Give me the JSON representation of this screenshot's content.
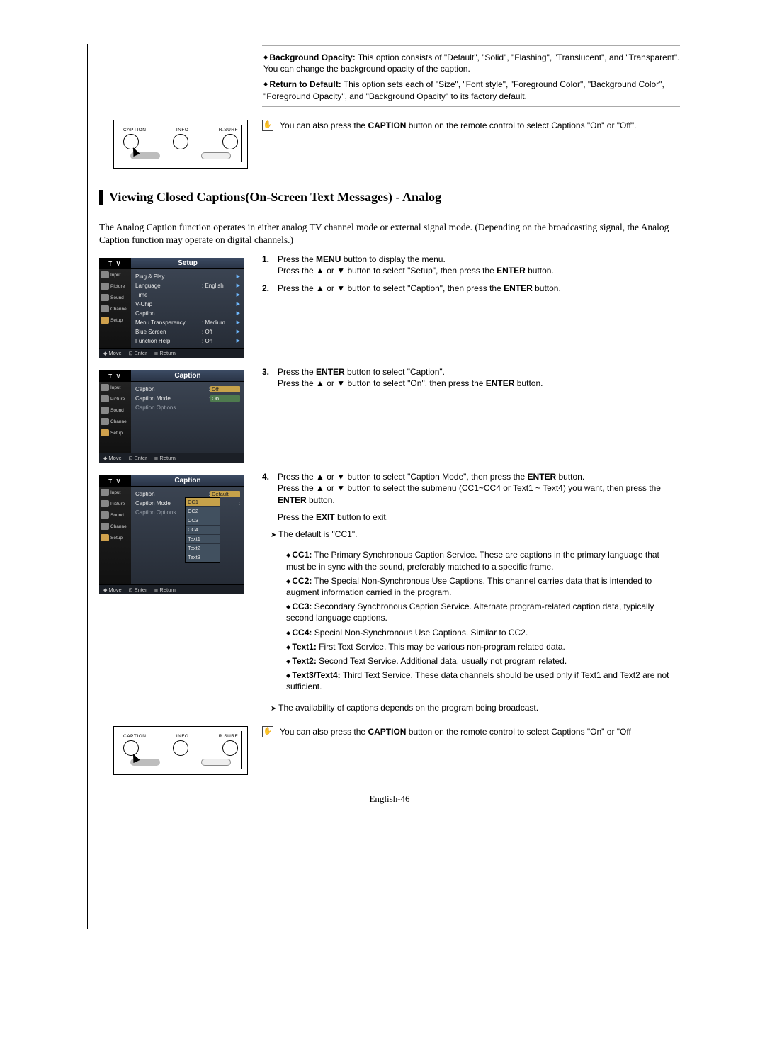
{
  "top_options": {
    "bg_opacity_label": "Background Opacity:",
    "bg_opacity_text": " This option consists of \"Default\", \"Solid\", \"Flashing\", \"Translucent\", and \"Transparent\". You can change the background opacity of the caption.",
    "return_default_label": "Return to Default:",
    "return_default_text": " This option sets each of \"Size\", \"Font style\", \"Foreground Color\", \"Background Color\", \"Foreground Opacity\", and \"Background Opacity\" to its factory default."
  },
  "caption_note_top_pre": "You can also press the ",
  "caption_note_top_bold": "CAPTION",
  "caption_note_top_post": " button on the remote control to select Captions \"On\" or \"Off\".",
  "remote": {
    "btn1": "CAPTION",
    "btn2": "INFO",
    "btn3": "R.SURF"
  },
  "section_title": "Viewing Closed Captions(On-Screen Text Messages) - Analog",
  "intro_para": "The Analog Caption function operates in either analog TV channel mode or external signal mode. (Depending on the broadcasting signal, the Analog Caption function may operate on digital channels.)",
  "osd": {
    "tv": "T V",
    "title_setup": "Setup",
    "title_caption": "Caption",
    "side": {
      "input": "Input",
      "picture": "Picture",
      "sound": "Sound",
      "channel": "Channel",
      "setup": "Setup"
    },
    "foot": {
      "move": "Move",
      "enter": "Enter",
      "return": "Return"
    },
    "setup_rows": {
      "plugplay": "Plug & Play",
      "language": "Language",
      "language_val": ": English",
      "time": "Time",
      "vchip": "V-Chip",
      "caption": "Caption",
      "menutrans": "Menu Transparency",
      "menutrans_val": ": Medium",
      "bluescreen": "Blue Screen",
      "bluescreen_val": ": Off",
      "funchelp": "Function Help",
      "funchelp_val": ": On"
    },
    "cap_rows": {
      "caption": "Caption",
      "caption_off": "Off",
      "caption_on": "On",
      "capmode": "Caption Mode",
      "capoptions": "Caption Options",
      "default": "Default",
      "cc1": "CC1",
      "cc2": "CC2",
      "cc3": "CC3",
      "cc4": "CC4",
      "t1": "Text1",
      "t2": "Text2",
      "t3": "Text3"
    }
  },
  "steps": {
    "s1a_pre": "Press the ",
    "s1a_b": "MENU",
    "s1a_post": " button to display the menu.",
    "s1b": "Press the ▲ or ▼ button to select \"Setup\", then press the ",
    "s1b_b": "ENTER",
    "s1b_post": " button.",
    "s2": "Press the ▲ or ▼ button to select \"Caption\", then press the ",
    "s2_b": "ENTER",
    "s2_post": " button.",
    "s3a": "Press the ",
    "s3a_b": "ENTER",
    "s3a_post": " button to select \"Caption\".",
    "s3b": "Press the ▲ or ▼ button to select \"On\", then press the ",
    "s3b_b": "ENTER",
    "s3b_post": " button.",
    "s4a": "Press the ▲ or ▼ button to select \"Caption Mode\", then press the ",
    "s4a_b": "ENTER",
    "s4a_post": " button.",
    "s4b": "Press the ▲ or ▼ button to select the submenu (CC1~CC4 or Text1 ~ Text4) you want, then press the ",
    "s4b_b": "ENTER",
    "s4b_post": " button.",
    "s4c_pre": "Press the ",
    "s4c_b": "EXIT",
    "s4c_post": " button to exit."
  },
  "default_note": "The default is \"CC1\".",
  "cc_desc": {
    "cc1_b": "CC1:",
    "cc1": " The Primary Synchronous Caption Service. These are captions in the primary language that must be in sync with the sound, preferably matched to a specific frame.",
    "cc2_b": "CC2:",
    "cc2": " The Special Non-Synchronous Use Captions. This channel carries data that is intended to augment information carried in the program.",
    "cc3_b": "CC3:",
    "cc3": " Secondary Synchronous Caption Service. Alternate program-related caption data, typically second language captions.",
    "cc4_b": "CC4:",
    "cc4": " Special Non-Synchronous Use Captions. Similar to CC2.",
    "t1_b": "Text1:",
    "t1": " First Text Service. This may be various non-program related data.",
    "t2_b": "Text2:",
    "t2": " Second Text Service. Additional data, usually not program related.",
    "t34_b": "Text3/Text4:",
    "t34": " Third Text Service. These data channels should be used only if Text1 and Text2 are not sufficient."
  },
  "avail_note": "The availability of captions depends on the program being broadcast.",
  "caption_note_bot_pre": "You can also press the ",
  "caption_note_bot_b": "CAPTION",
  "caption_note_bot_post": " button on the remote control to select Captions \"On\" or \"Off",
  "page_foot": "English-46"
}
